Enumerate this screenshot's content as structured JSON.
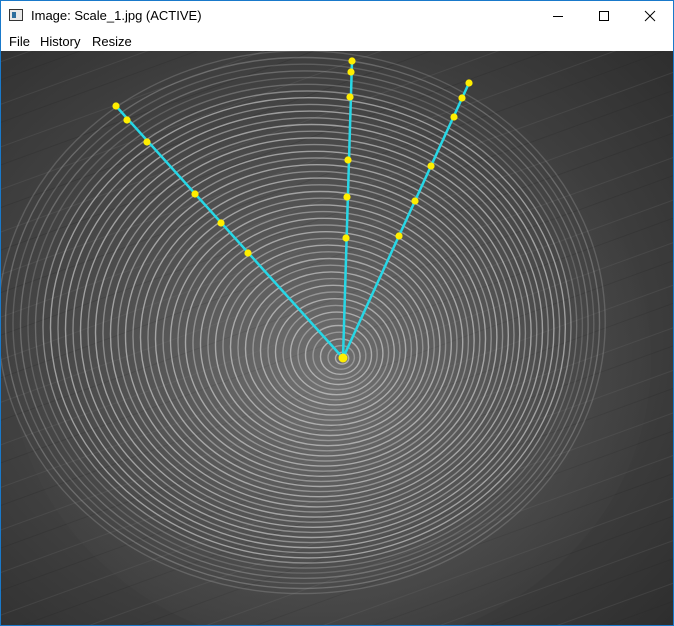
{
  "window": {
    "title": "Image: Scale_1.jpg (ACTIVE)",
    "controls": {
      "minimize": "minimize-icon",
      "maximize": "maximize-icon",
      "close": "close-icon"
    }
  },
  "menu": {
    "items": [
      {
        "label": "File"
      },
      {
        "label": "History"
      },
      {
        "label": "Resize"
      }
    ]
  },
  "image": {
    "content": "fish scale micrograph with concentric circuli",
    "overlay": {
      "line_color": "#27d7e6",
      "point_color": "#ffee00"
    }
  }
}
